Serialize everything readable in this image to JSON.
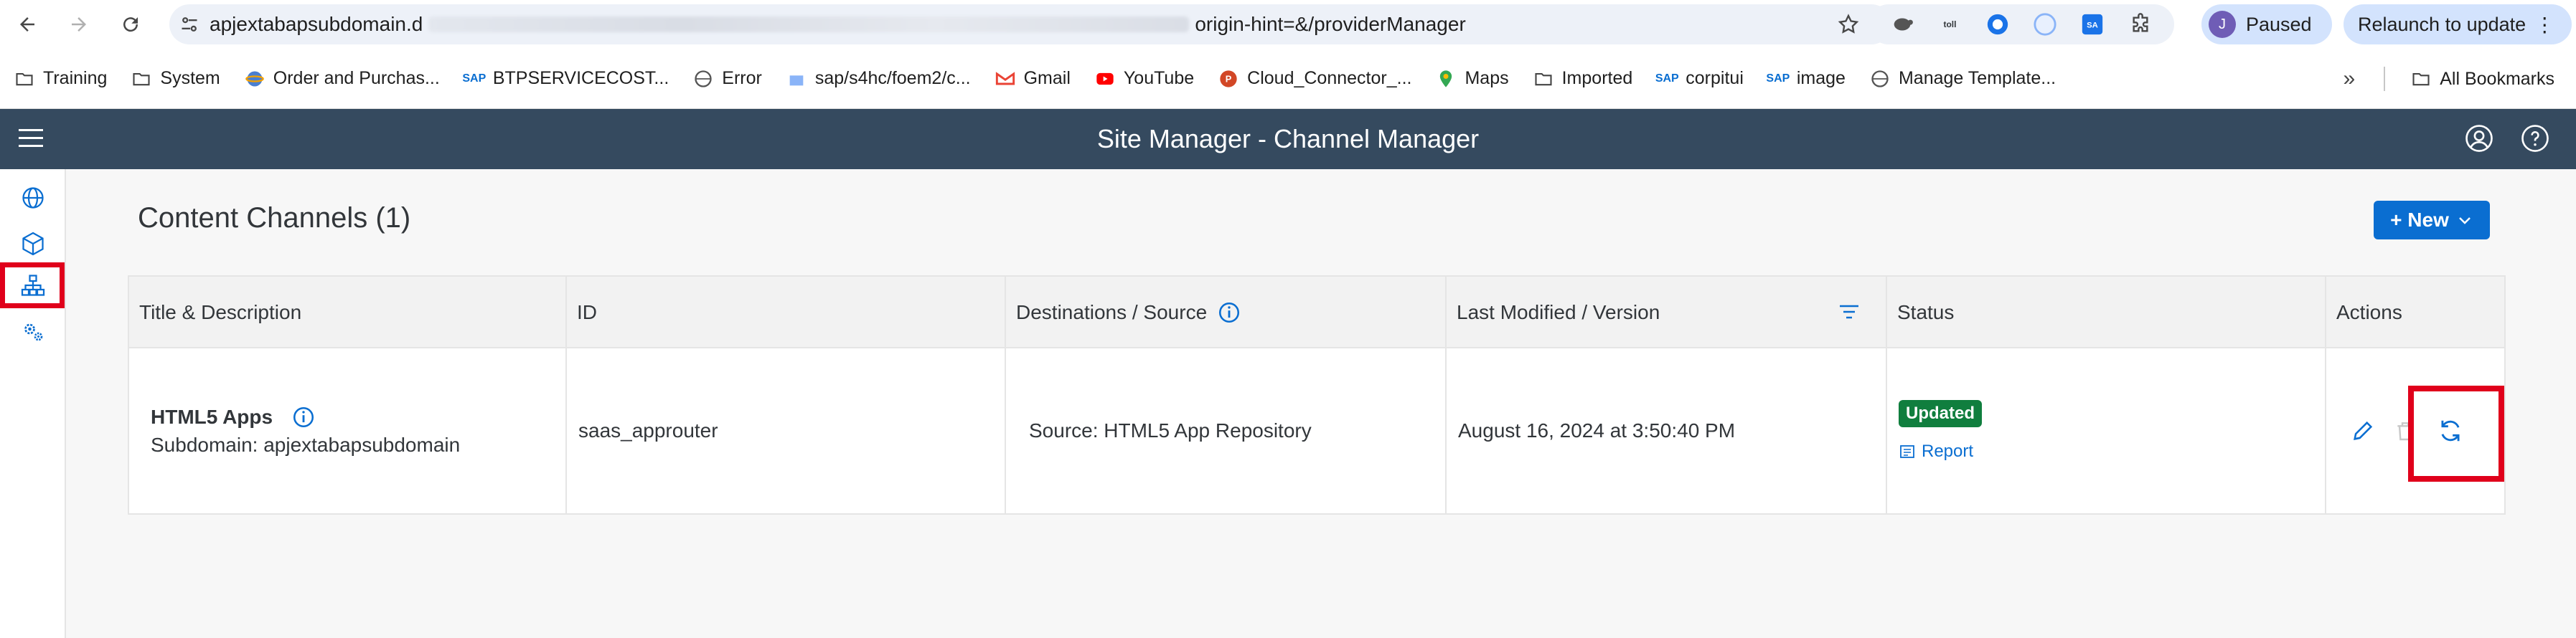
{
  "browser": {
    "url_prefix": "apjextabapsubdomain.d",
    "url_suffix": "origin-hint=&/providerManager",
    "profile_initial": "J",
    "profile_status": "Paused",
    "relaunch_label": "Relaunch to update",
    "bookmarks": [
      {
        "label": "Training",
        "icon": "folder-icon"
      },
      {
        "label": "System",
        "icon": "folder-icon"
      },
      {
        "label": "Order and Purchas...",
        "icon": "globe-icon"
      },
      {
        "label": "BTPSERVICECOST...",
        "icon": "sap-icon"
      },
      {
        "label": "Error",
        "icon": "globe-icon"
      },
      {
        "label": "sap/s4hc/foem2/c...",
        "icon": "page-icon"
      },
      {
        "label": "Gmail",
        "icon": "gmail-icon"
      },
      {
        "label": "YouTube",
        "icon": "youtube-icon"
      },
      {
        "label": "Cloud_Connector_...",
        "icon": "powerpoint-icon"
      },
      {
        "label": "Maps",
        "icon": "maps-icon"
      },
      {
        "label": "Imported",
        "icon": "folder-icon"
      },
      {
        "label": "corpitui",
        "icon": "sap-icon"
      },
      {
        "label": "image",
        "icon": "sap-icon"
      },
      {
        "label": "Manage Template...",
        "icon": "globe-icon"
      }
    ],
    "all_bookmarks_label": "All Bookmarks"
  },
  "shell": {
    "title": "Site Manager - Channel Manager"
  },
  "page": {
    "title": "Content Channels (1)",
    "new_button": "+ New"
  },
  "table": {
    "columns": [
      "Title & Description",
      "ID",
      "Destinations / Source",
      "Last Modified / Version",
      "Status",
      "Actions"
    ],
    "rows": [
      {
        "title": "HTML5 Apps",
        "subdomain": "Subdomain: apjextabapsubdomain",
        "id": "saas_approuter",
        "source": "Source: HTML5 App Repository",
        "modified": "August 16, 2024 at 3:50:40 PM",
        "status": "Updated",
        "report": "Report"
      }
    ]
  },
  "colors": {
    "shell": "#354a5f",
    "accent": "#0a6ed1",
    "status_success": "#107e3e",
    "highlight": "#e0001b"
  }
}
